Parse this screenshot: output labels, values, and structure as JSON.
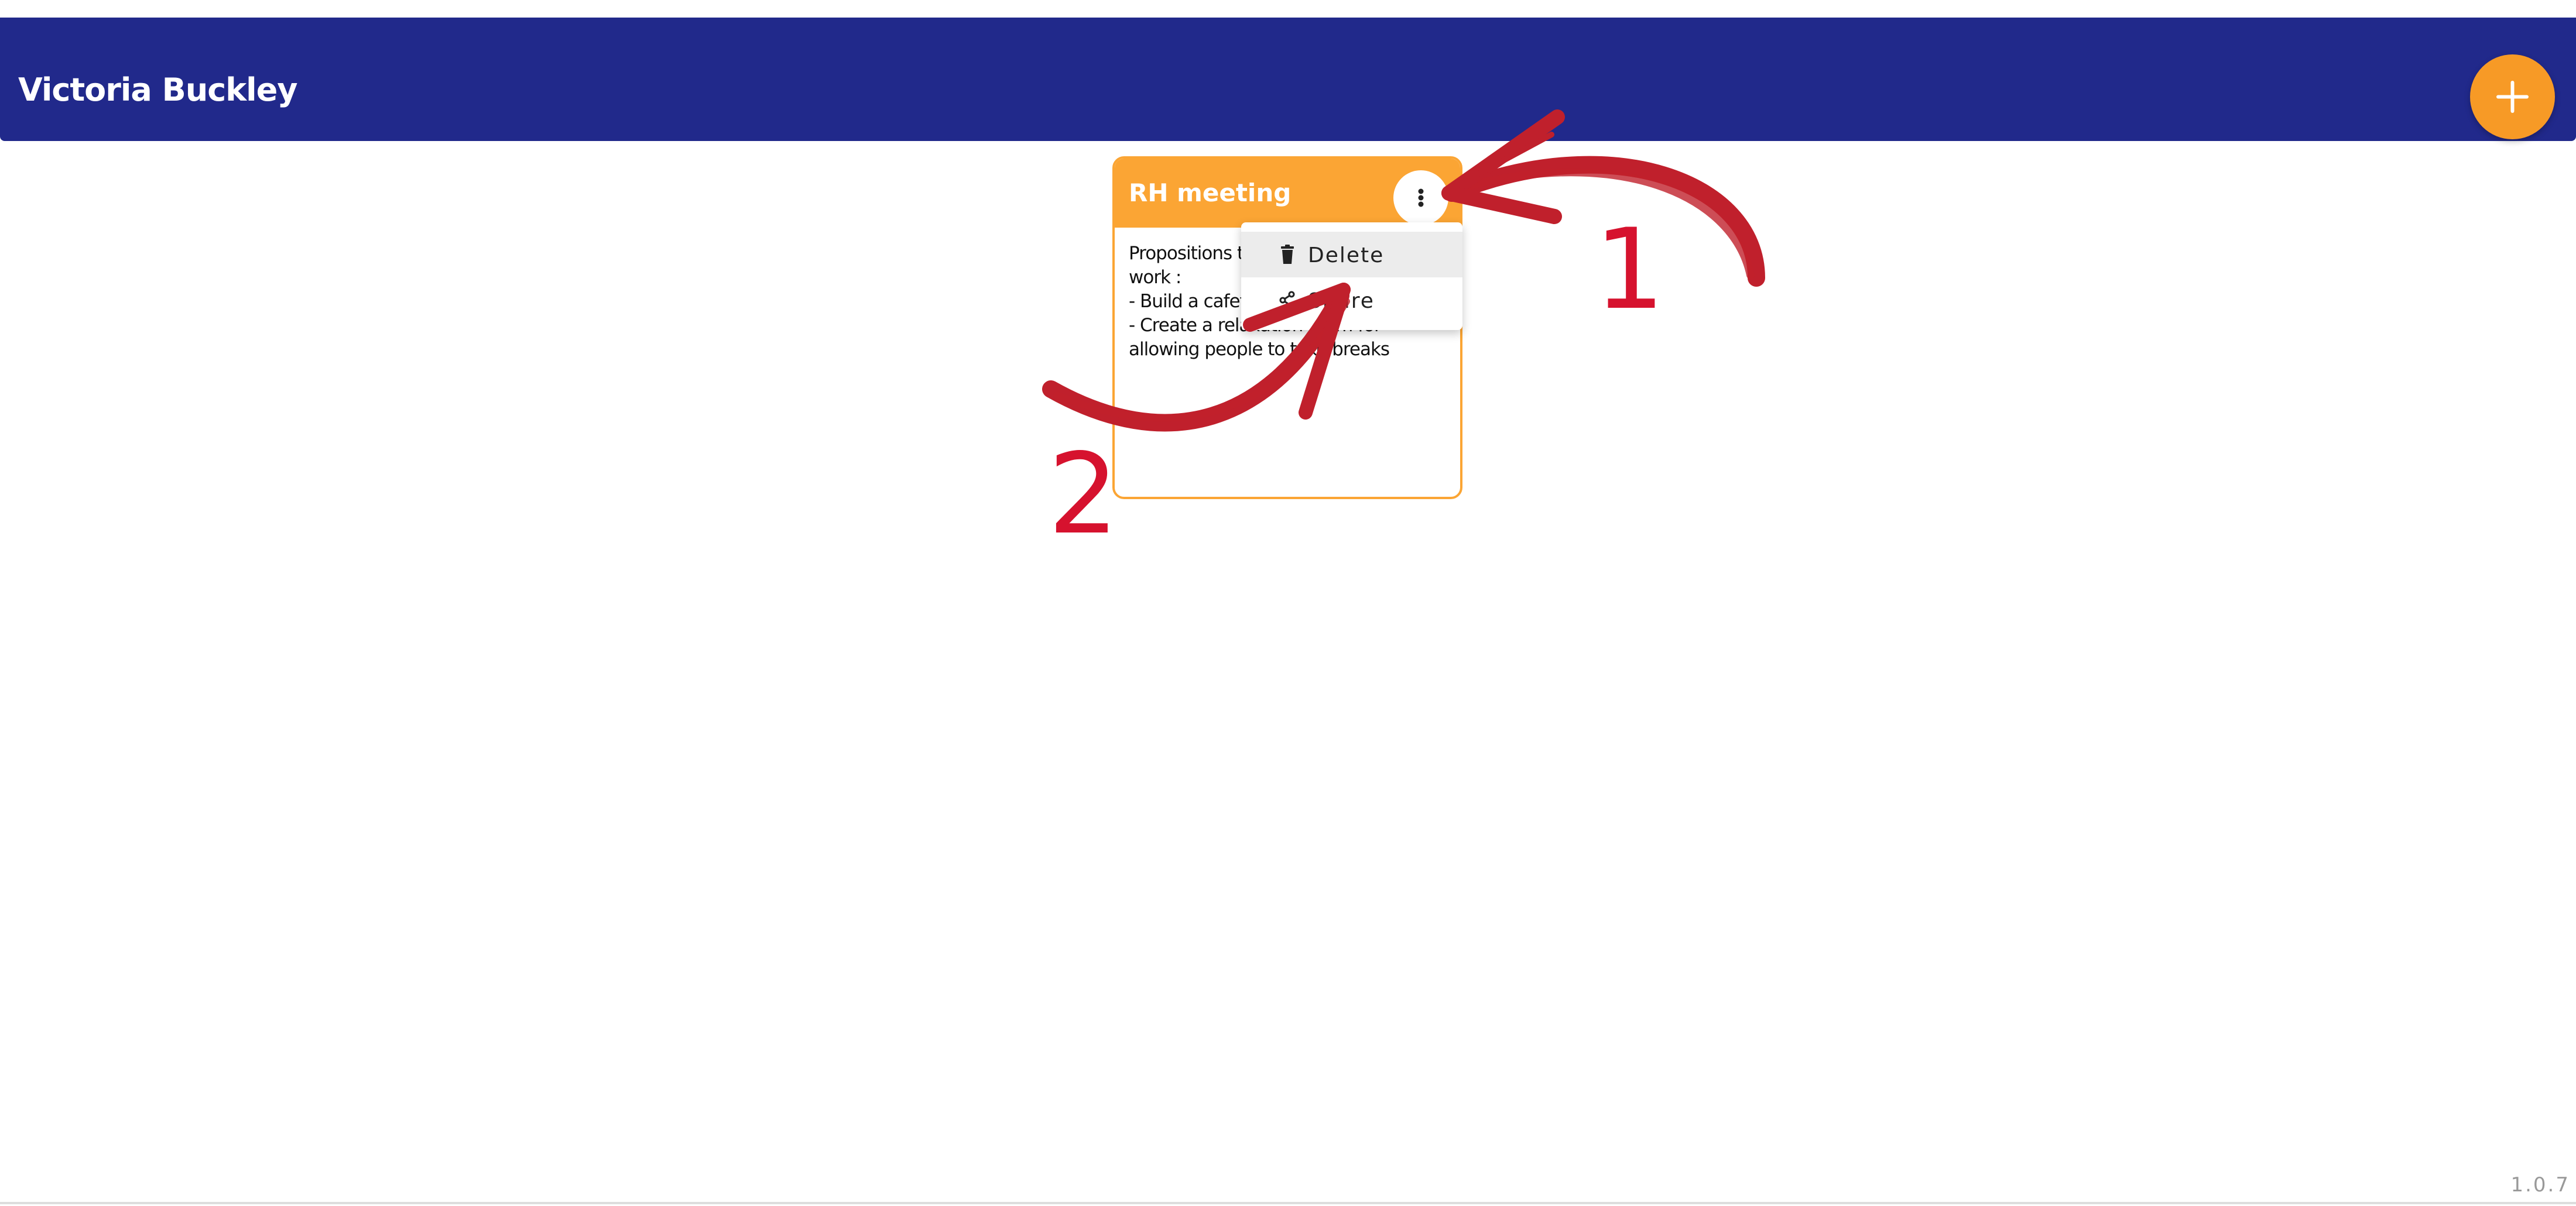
{
  "header": {
    "user_name": "Victoria Buckley",
    "add_icon": "plus-icon",
    "background": "#21298b"
  },
  "note": {
    "title": "RH meeting",
    "body": "Propositions to improve breaks at work :\n- Build a cafeteria\n- Create a relaxation room for allowing people to take breaks",
    "menu_icon": "more-vertical-icon",
    "accent": "#fba534"
  },
  "context_menu": {
    "items": [
      {
        "label": "Delete",
        "icon": "trash-icon"
      },
      {
        "label": "Share",
        "icon": "share-icon"
      }
    ]
  },
  "annotations": {
    "step_1": "1",
    "step_2": "2",
    "color": "#d6122e"
  },
  "footer": {
    "version": "1.0.7"
  }
}
